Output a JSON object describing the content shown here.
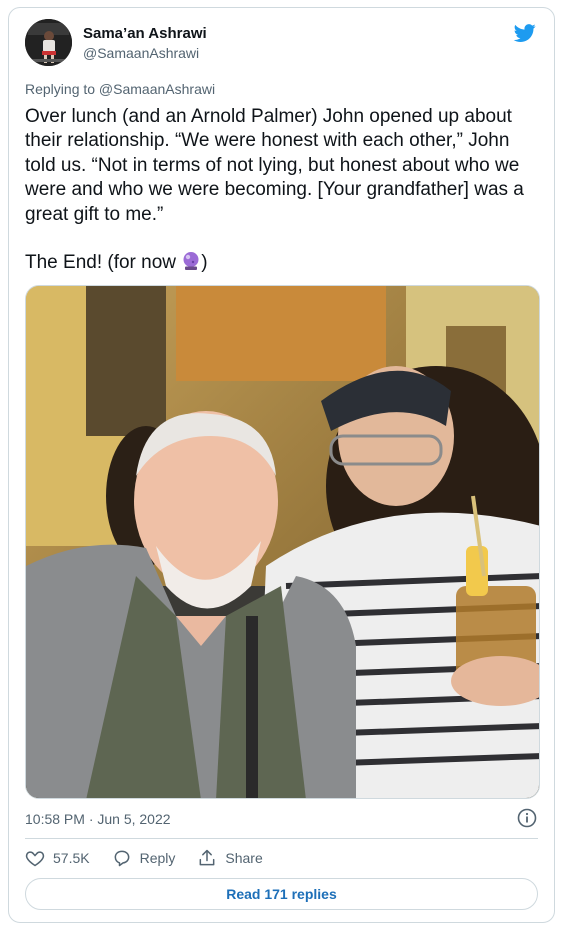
{
  "author": {
    "name": "Sama’an Ashrawi",
    "handle": "@SamaanAshrawi",
    "avatar_icon": "profile-photo"
  },
  "reply_context": "Replying to @SamaanAshrawi",
  "tweet": {
    "text": "Over lunch (and an Arnold Palmer) John opened up about their relationship. “We were honest with each other,” John told us. “Not in terms of not lying, but honest about who we were and who we were becoming. [Your grandfather] was a great gift to me.”",
    "text_end_prefix": "The End! (for now ",
    "text_end_suffix": ")",
    "emoji_icon": "crystal-ball-icon"
  },
  "photo": {
    "icon": "photo-of-two-men-smiling"
  },
  "meta": {
    "timestamp": "10:58 PM · Jun 5, 2022"
  },
  "actions": {
    "likes": "57.5K",
    "reply_label": "Reply",
    "share_label": "Share"
  },
  "read_replies_label": "Read 171 replies",
  "colors": {
    "twitter_blue": "#1d9bf0",
    "link_blue": "#1d6fb8",
    "secondary_text": "#536471",
    "border": "#cfd9de"
  }
}
